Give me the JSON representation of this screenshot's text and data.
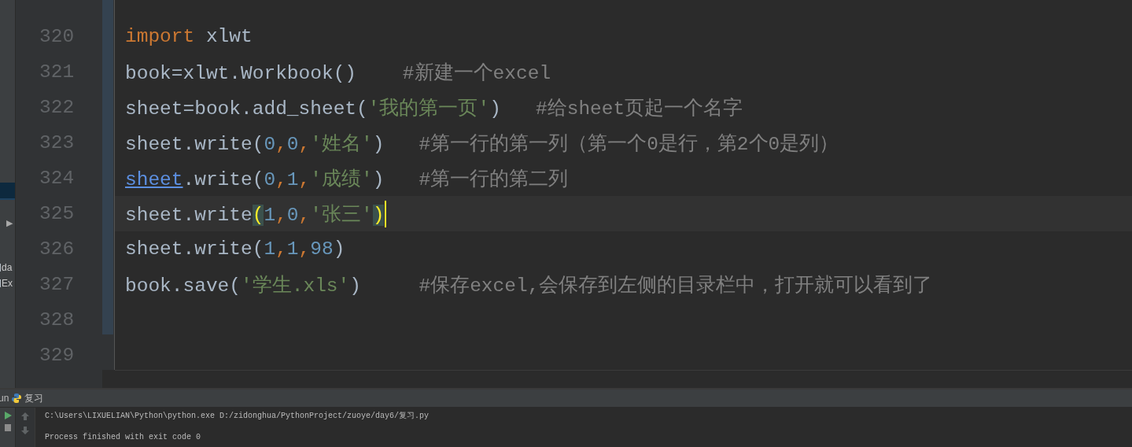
{
  "sidebar": {
    "items": [
      {
        "kind": "row",
        "selected": true
      },
      {
        "kind": "expander",
        "text": "▶"
      },
      {
        "kind": "entry",
        "text": "da"
      },
      {
        "kind": "entry",
        "text": "Ex"
      }
    ]
  },
  "editor": {
    "lines": [
      {
        "number": "320",
        "caret": false,
        "tokens": [
          {
            "kind": "keyword",
            "text": "import"
          },
          {
            "kind": "plain",
            "text": " xlwt"
          }
        ]
      },
      {
        "number": "321",
        "caret": false,
        "tokens": [
          {
            "kind": "plain",
            "text": "book=xlwt.Workbook()"
          },
          {
            "kind": "comment",
            "text": "    #新建一个excel"
          }
        ]
      },
      {
        "number": "322",
        "caret": false,
        "tokens": [
          {
            "kind": "plain",
            "text": "sheet=book.add_sheet("
          },
          {
            "kind": "string",
            "text": "'我的第一页'"
          },
          {
            "kind": "plain",
            "text": ")"
          },
          {
            "kind": "comment",
            "text": "   #给sheet页起一个名字"
          }
        ]
      },
      {
        "number": "323",
        "caret": false,
        "tokens": [
          {
            "kind": "plain",
            "text": "sheet.write("
          },
          {
            "kind": "number",
            "text": "0"
          },
          {
            "kind": "keyword",
            "text": ","
          },
          {
            "kind": "number",
            "text": "0"
          },
          {
            "kind": "keyword",
            "text": ","
          },
          {
            "kind": "string",
            "text": "'姓名'"
          },
          {
            "kind": "plain",
            "text": ")"
          },
          {
            "kind": "comment",
            "text": "   #第一行的第一列（第一个0是行，第2个0是列）"
          }
        ]
      },
      {
        "number": "324",
        "caret": false,
        "tokens": [
          {
            "kind": "link",
            "text": "sheet"
          },
          {
            "kind": "plain",
            "text": ".write("
          },
          {
            "kind": "number",
            "text": "0"
          },
          {
            "kind": "keyword",
            "text": ","
          },
          {
            "kind": "number",
            "text": "1"
          },
          {
            "kind": "keyword",
            "text": ","
          },
          {
            "kind": "string",
            "text": "'成绩'"
          },
          {
            "kind": "plain",
            "text": ")"
          },
          {
            "kind": "comment",
            "text": "   #第一行的第二列"
          }
        ]
      },
      {
        "number": "325",
        "caret": true,
        "tokens": [
          {
            "kind": "plain",
            "text": "sheet.write"
          },
          {
            "kind": "match",
            "text": "("
          },
          {
            "kind": "number",
            "text": "1"
          },
          {
            "kind": "keyword",
            "text": ","
          },
          {
            "kind": "number",
            "text": "0"
          },
          {
            "kind": "keyword",
            "text": ","
          },
          {
            "kind": "string",
            "text": "'张三'"
          },
          {
            "kind": "match",
            "text": ")"
          }
        ]
      },
      {
        "number": "326",
        "caret": false,
        "tokens": [
          {
            "kind": "plain",
            "text": "sheet.write("
          },
          {
            "kind": "number",
            "text": "1"
          },
          {
            "kind": "keyword",
            "text": ","
          },
          {
            "kind": "number",
            "text": "1"
          },
          {
            "kind": "keyword",
            "text": ","
          },
          {
            "kind": "number",
            "text": "98"
          },
          {
            "kind": "plain",
            "text": ")"
          }
        ]
      },
      {
        "number": "327",
        "caret": false,
        "tokens": [
          {
            "kind": "plain",
            "text": "book.save("
          },
          {
            "kind": "string",
            "text": "'学生.xls'"
          },
          {
            "kind": "plain",
            "text": ")"
          },
          {
            "kind": "comment",
            "text": "     #保存excel,会保存到左侧的目录栏中，打开就可以看到了"
          }
        ]
      },
      {
        "number": "328",
        "caret": false
      },
      {
        "number": "329",
        "caret": false
      }
    ]
  },
  "run_panel": {
    "label": "un",
    "tab": "复习",
    "console": [
      "C:\\Users\\LIXUELIAN\\Python\\python.exe D:/zidonghua/PythonProject/zuoye/day6/复习.py",
      "Process finished with exit code 0"
    ]
  }
}
